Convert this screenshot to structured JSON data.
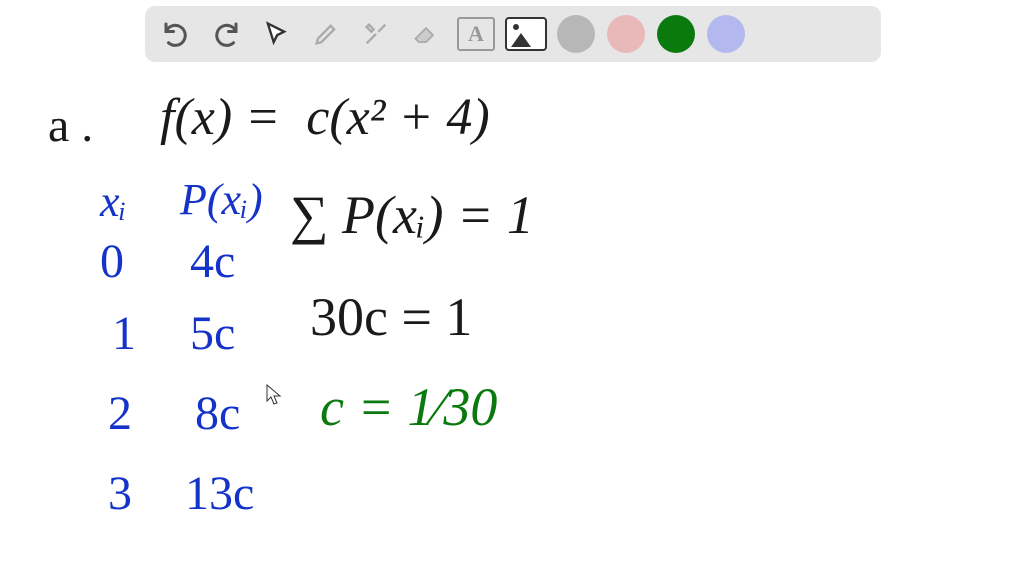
{
  "toolbar": {
    "icons": {
      "undo": "undo-icon",
      "redo": "redo-icon",
      "select": "cursor-icon",
      "pen": "pen-icon",
      "tools": "tools-icon",
      "eraser": "eraser-icon",
      "text": "A",
      "image": "image-icon"
    },
    "swatches": [
      {
        "name": "gray",
        "hex": "#b7b7b7"
      },
      {
        "name": "pink",
        "hex": "#e9b8b8"
      },
      {
        "name": "green",
        "hex": "#0a7a0f"
      },
      {
        "name": "lavender",
        "hex": "#b3b9ef"
      }
    ]
  },
  "handwriting": {
    "part_label": "a .",
    "equation": "f(x) =  c(x² + 4)",
    "table_header_xi": "xᵢ",
    "table_header_pxi": "P(xᵢ)",
    "row0_x": "0",
    "row0_p": "4c",
    "row1_x": "1",
    "row1_p": "5c",
    "row2_x": "2",
    "row2_p": "8c",
    "row3_x": "3",
    "row3_p": "13c",
    "sum_eq": "∑ P(xᵢ) = 1",
    "c30": "30c = 1",
    "c_solution": "c = 1⁄30"
  }
}
